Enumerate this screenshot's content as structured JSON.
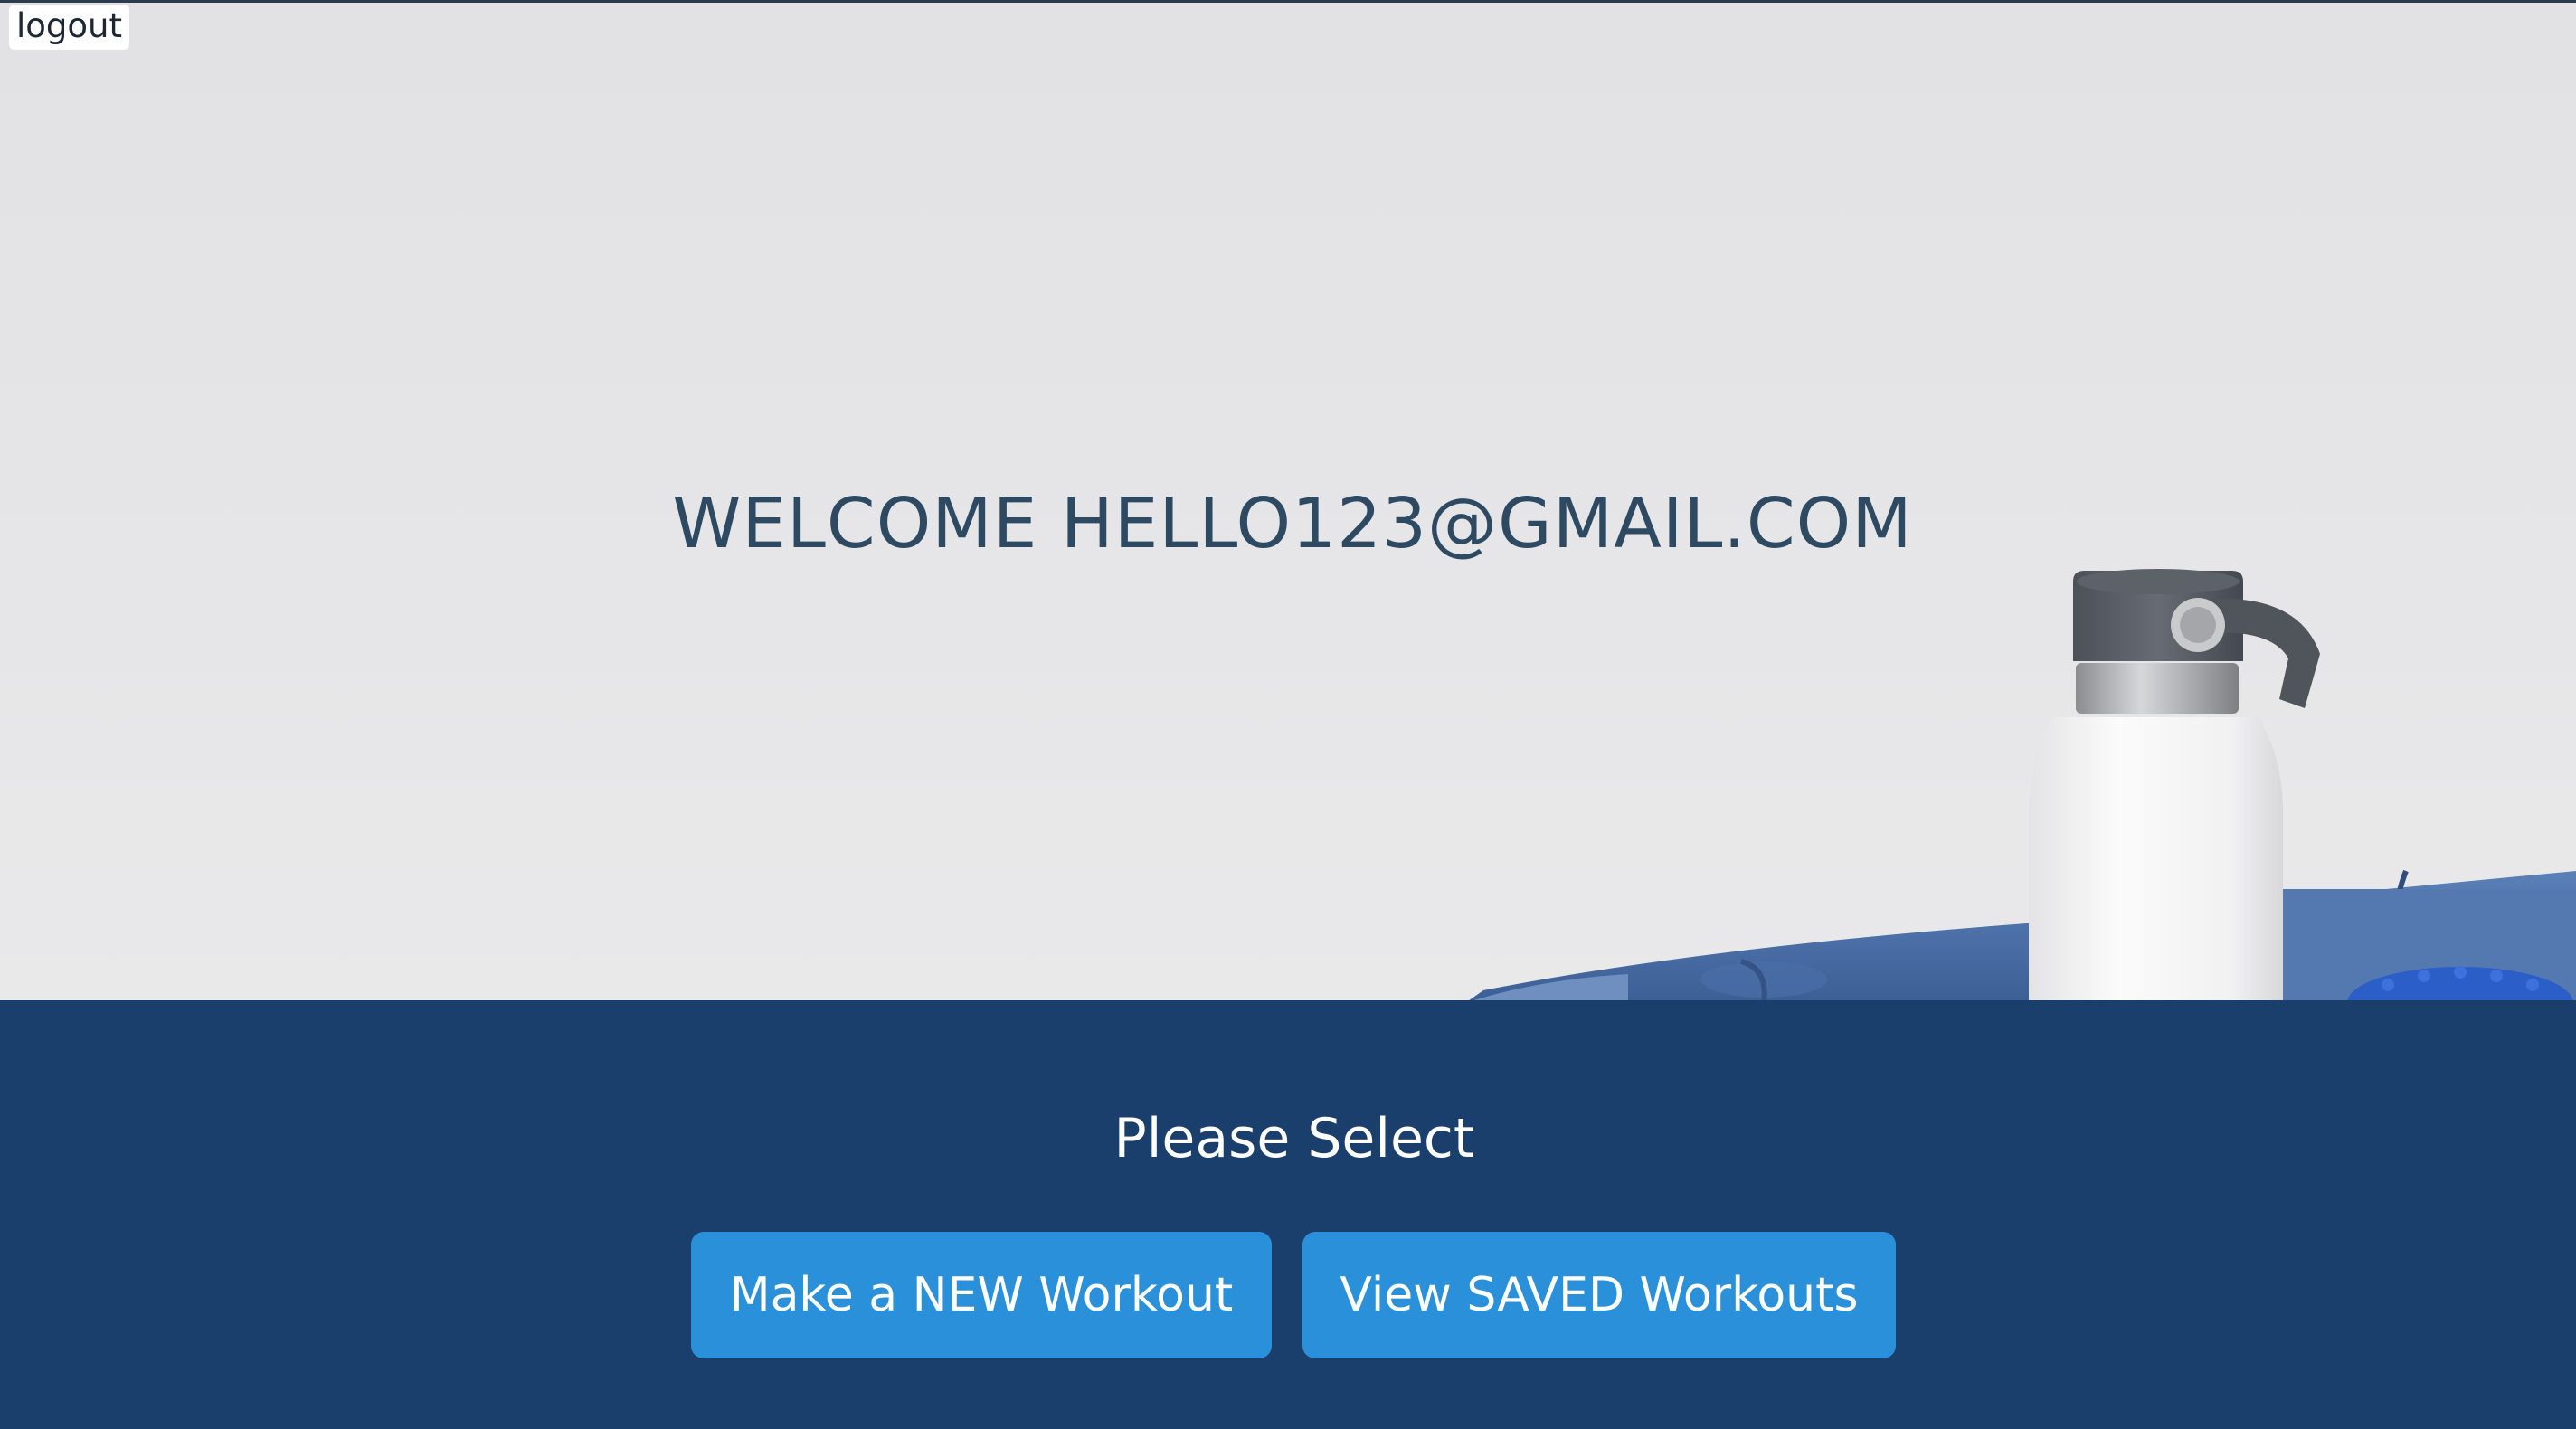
{
  "header": {
    "logout_label": "logout"
  },
  "hero": {
    "welcome_text": "WELCOME HELLO123@GMAIL.COM"
  },
  "selection": {
    "title": "Please Select",
    "new_workout_label": "Make a NEW Workout",
    "saved_workouts_label": "View SAVED Workouts"
  },
  "colors": {
    "panel_background": "#1a3f6c",
    "button_accent": "#2a90d9",
    "welcome_text": "#2e4a63"
  }
}
